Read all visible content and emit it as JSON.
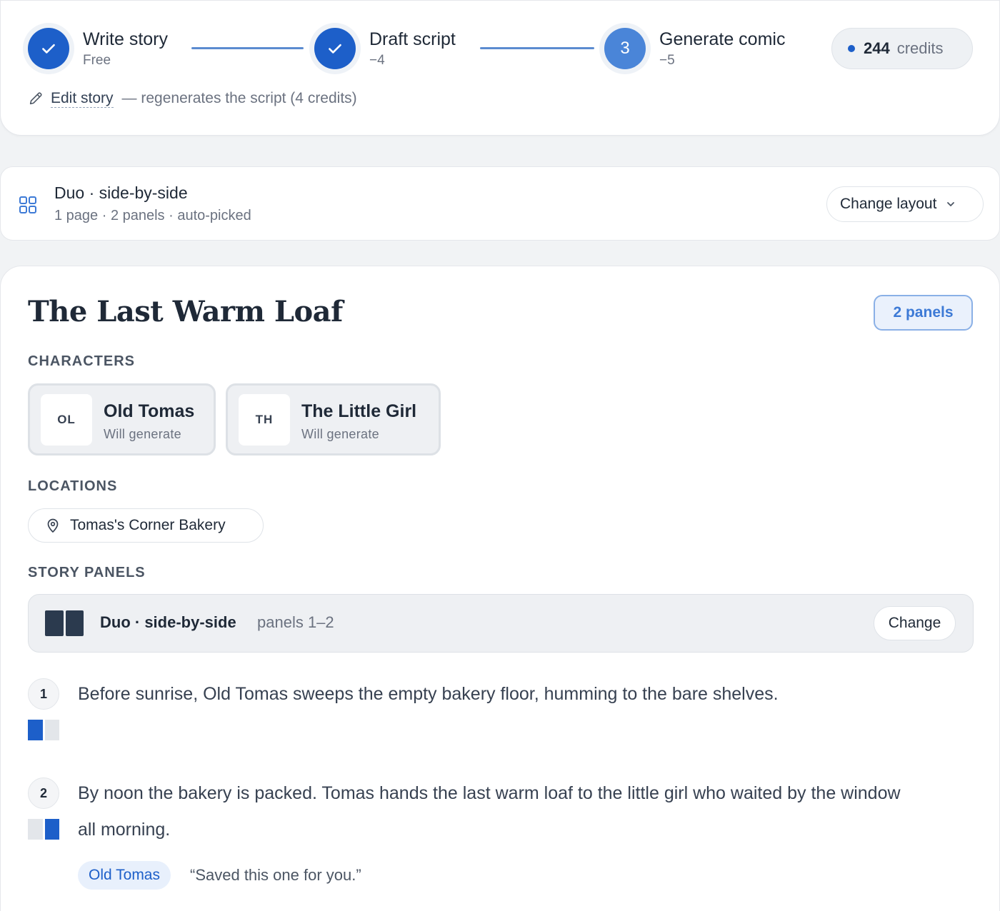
{
  "stepper": {
    "steps": [
      {
        "title": "Write story",
        "sub": "Free",
        "state": "done"
      },
      {
        "title": "Draft script",
        "sub": "−4",
        "state": "done"
      },
      {
        "title": "Generate comic",
        "sub": "−5",
        "state": "current",
        "number": "3"
      }
    ],
    "credits": {
      "amount": "244",
      "unit": "credits"
    },
    "edit": {
      "link": "Edit story",
      "note": "— regenerates the script (4 credits)"
    }
  },
  "layout": {
    "title": "Duo · side-by-side",
    "meta": "1 page · 2 panels · auto-picked",
    "change_label": "Change layout"
  },
  "story": {
    "title": "The Last Warm Loaf",
    "panels_badge": "2 panels",
    "characters_label": "CHARACTERS",
    "characters": [
      {
        "initials": "OL",
        "name": "Old Tomas",
        "status": "Will generate"
      },
      {
        "initials": "TH",
        "name": "The Little Girl",
        "status": "Will generate"
      }
    ],
    "locations_label": "LOCATIONS",
    "locations": [
      "Tomas's Corner Bakery"
    ],
    "panels_label": "STORY PANELS",
    "layout_bar": {
      "name": "Duo · side-by-side",
      "range": "panels 1–2",
      "change_label": "Change"
    },
    "panels": [
      {
        "number": "1",
        "text": "Before sunrise, Old Tomas sweeps the empty bakery floor, humming to the bare shelves.",
        "slot": 1
      },
      {
        "number": "2",
        "text": "By noon the bakery is packed. Tomas hands the last warm loaf to the little girl who waited by the window all morning.",
        "slot": 2,
        "dialogue": {
          "speaker": "Old Tomas",
          "line": "“Saved this one for you.”"
        }
      }
    ]
  },
  "colors": {
    "accent": "#1d5fc9",
    "current_step": "#4a85d8"
  },
  "icons": {
    "check": "check-icon",
    "pencil": "pencil-icon",
    "grid": "grid-icon",
    "chevron": "chevron-down-icon",
    "pin": "map-pin-icon"
  }
}
